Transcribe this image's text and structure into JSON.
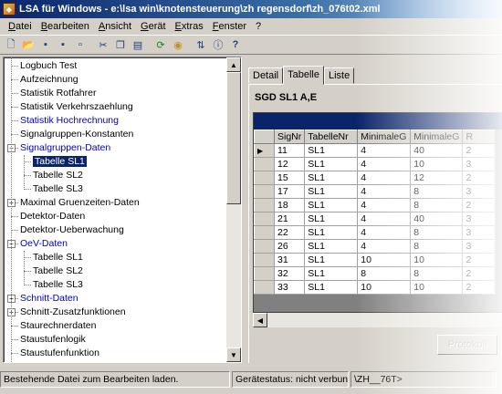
{
  "window": {
    "title": "LSA für Windows - e:\\lsa win\\knotensteuerung\\zh regensdorf\\zh_076t02.xml"
  },
  "menu": [
    "Datei",
    "Bearbeiten",
    "Ansicht",
    "Gerät",
    "Extras",
    "Fenster",
    "?"
  ],
  "toolbar": {
    "buttons": [
      "new-file-icon",
      "open-folder-icon",
      "save-icon",
      "save-all-icon",
      "print-preview-icon",
      "cut-icon",
      "copy-icon",
      "paste-icon",
      "refresh-icon",
      "device-icon",
      "transfer-icon",
      "info-icon",
      "help-icon"
    ]
  },
  "tree": {
    "items": [
      {
        "label": "Logbuch Test",
        "level": 1,
        "link": false
      },
      {
        "label": "Aufzeichnung",
        "level": 1,
        "link": false
      },
      {
        "label": "Statistik Rotfahrer",
        "level": 1,
        "link": false
      },
      {
        "label": "Statistik Verkehrszaehlung",
        "level": 1,
        "link": false
      },
      {
        "label": "Statistik Hochrechnung",
        "level": 1,
        "link": true
      },
      {
        "label": "Signalgruppen-Konstanten",
        "level": 1,
        "link": false
      },
      {
        "label": "Signalgruppen-Daten",
        "level": 1,
        "link": true,
        "expander": "−"
      },
      {
        "label": "Tabelle SL1",
        "level": 2,
        "link": false,
        "selected": true
      },
      {
        "label": "Tabelle SL2",
        "level": 2,
        "link": false
      },
      {
        "label": "Tabelle SL3",
        "level": 2,
        "link": false
      },
      {
        "label": "Maximal Gruenzeiten-Daten",
        "level": 1,
        "link": false,
        "expander": "+"
      },
      {
        "label": "Detektor-Daten",
        "level": 1,
        "link": false
      },
      {
        "label": "Detektor-Ueberwachung",
        "level": 1,
        "link": false
      },
      {
        "label": "OeV-Daten",
        "level": 1,
        "link": true,
        "expander": "−"
      },
      {
        "label": "Tabelle SL1",
        "level": 2,
        "link": false
      },
      {
        "label": "Tabelle SL2",
        "level": 2,
        "link": false
      },
      {
        "label": "Tabelle SL3",
        "level": 2,
        "link": false
      },
      {
        "label": "Schnitt-Daten",
        "level": 1,
        "link": true,
        "expander": "+"
      },
      {
        "label": "Schnitt-Zusatzfunktionen",
        "level": 1,
        "link": false,
        "expander": "+"
      },
      {
        "label": "Staurechnerdaten",
        "level": 1,
        "link": false
      },
      {
        "label": "Staustufenlogik",
        "level": 1,
        "link": false
      },
      {
        "label": "Staustufenfunktion",
        "level": 1,
        "link": false
      }
    ]
  },
  "tabs": [
    {
      "label": "Detail",
      "active": false
    },
    {
      "label": "Tabelle",
      "active": true
    },
    {
      "label": "Liste",
      "active": false
    }
  ],
  "detail": {
    "title": "SGD SL1 A,E",
    "columns": [
      "SigNr",
      "TabelleNr",
      "MinimaleG",
      "MinimaleG",
      "R"
    ],
    "rows": [
      [
        "11",
        "SL1",
        "4",
        "40",
        "2"
      ],
      [
        "12",
        "SL1",
        "4",
        "10",
        "3"
      ],
      [
        "15",
        "SL1",
        "4",
        "12",
        "2"
      ],
      [
        "17",
        "SL1",
        "4",
        "8",
        "3"
      ],
      [
        "18",
        "SL1",
        "4",
        "8",
        "2"
      ],
      [
        "21",
        "SL1",
        "4",
        "40",
        "3"
      ],
      [
        "22",
        "SL1",
        "4",
        "8",
        "3"
      ],
      [
        "26",
        "SL1",
        "4",
        "8",
        "3"
      ],
      [
        "31",
        "SL1",
        "10",
        "10",
        "2"
      ],
      [
        "32",
        "SL1",
        "8",
        "8",
        "2"
      ],
      [
        "33",
        "SL1",
        "10",
        "10",
        "2"
      ]
    ],
    "current_row_marker": "▶",
    "protokoll_label": "Protokoll"
  },
  "status": {
    "message": "Bestehende Datei zum Bearbeiten laden.",
    "device": "Gerätestatus: nicht verbunden",
    "file": "\\ZH__76T>"
  }
}
